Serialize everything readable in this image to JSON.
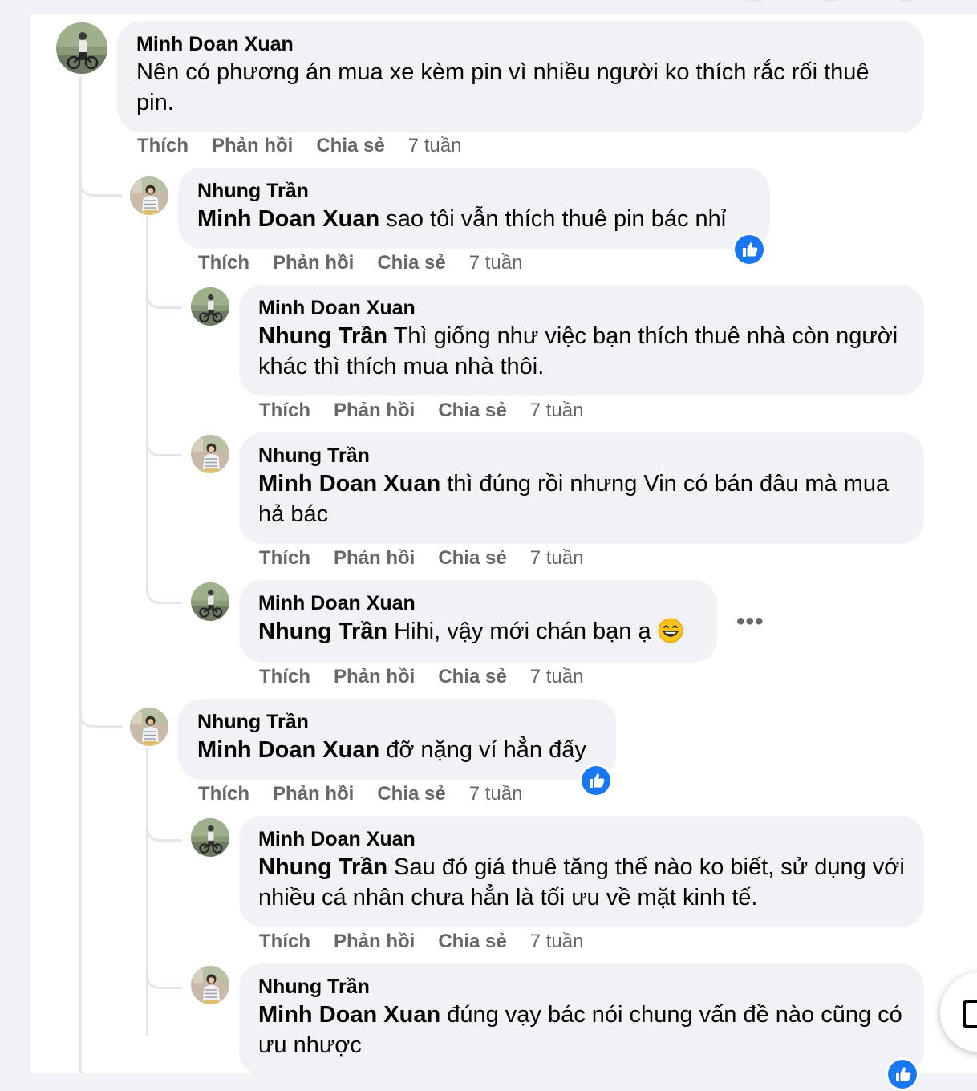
{
  "actions": {
    "like": "Thích",
    "reply": "Phản hồi",
    "share": "Chia sẻ"
  },
  "colors": {
    "bubble": "#f0f2f5",
    "meta": "#65676b",
    "like_blue": "#1877f2",
    "thread_line": "#e4e6eb"
  },
  "comments": [
    {
      "author": "Minh Doan Xuan",
      "mention": "",
      "text": "Nên có phương án mua xe kèm pin vì nhiều người ko thích rắc rối thuê pin.",
      "time": "7 tuần"
    },
    {
      "author": "Nhung Trần",
      "mention": "Minh Doan Xuan",
      "text": "sao tôi vẫn thích thuê pin bác nhỉ",
      "time": "7 tuần",
      "reaction_icon": "like-icon"
    },
    {
      "author": "Minh Doan Xuan",
      "mention": "Nhung Trần",
      "text": "Thì giống như việc bạn thích thuê nhà còn người khác thì thích mua nhà thôi.",
      "time": "7 tuần"
    },
    {
      "author": "Nhung Trần",
      "mention": "Minh Doan Xuan",
      "text": "thì đúng rồi nhưng Vin có bán đâu mà mua hả bác",
      "time": "7 tuần"
    },
    {
      "author": "Minh Doan Xuan",
      "mention": "Nhung Trần",
      "text": "Hihi, vậy mới chán bạn ạ",
      "time": "7 tuần",
      "emoji": "grinning-face-icon",
      "more_label": "•••"
    },
    {
      "author": "Nhung Trần",
      "mention": "Minh Doan Xuan",
      "text": "đỡ nặng ví hẳn đấy",
      "time": "7 tuần",
      "reaction_icon": "like-icon"
    },
    {
      "author": "Minh Doan Xuan",
      "mention": "Nhung Trần",
      "text": "Sau đó giá thuê tăng thế nào ko biết, sử dụng với nhiều cá nhân chưa hẳn là tối ưu về mặt kinh tế.",
      "time": "7 tuần"
    },
    {
      "author": "Nhung Trần",
      "mention": "Minh Doan Xuan",
      "text": "đúng vạy bác nói chung vấn đề nào cũng có ưu nhược",
      "time": ""
    }
  ]
}
